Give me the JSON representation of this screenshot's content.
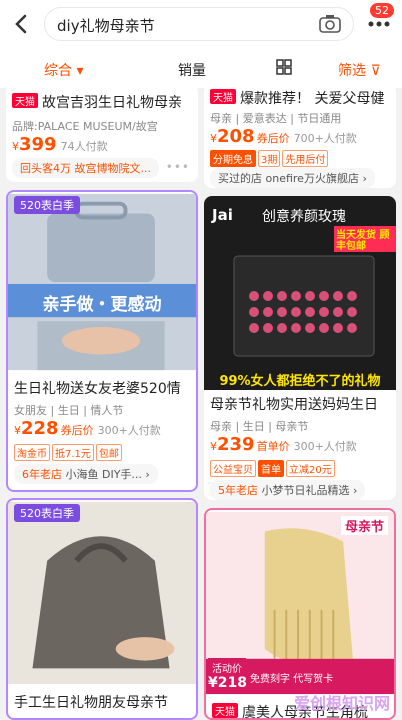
{
  "search": {
    "query": "diy礼物母亲节"
  },
  "notification_count": "52",
  "sort": {
    "comprehensive": "综合",
    "sales": "销量",
    "filter": "筛选"
  },
  "cards": [
    {
      "title": "故宫吉羽生日礼物母亲",
      "tag": "天猫",
      "attrs": "品牌:PALACE MUSEUM/故宫",
      "price": "399",
      "sold": "74人付款",
      "shop": "回头客4万 故宫博物院文..."
    },
    {
      "title": "爆款推荐！ 关爱父母健",
      "tag": "天猫",
      "attrs": "母亲 | 爱意表达 | 节日通用",
      "price": "208",
      "price_label": "券后价",
      "sold": "700+人付款",
      "chips": [
        "分期免息",
        "3期",
        "先用后付"
      ],
      "shop_prefix": "买过的店",
      "shop": "onefire万火旗舰店"
    },
    {
      "title": "生日礼物送女友老婆520情",
      "season": "520表白季",
      "banner": "亲手做・更感动",
      "attrs": "女朋友 | 生日 | 情人节",
      "price": "228",
      "price_label": "券后价",
      "sold": "300+人付款",
      "chips": [
        "淘金币",
        "抵7.1元",
        "包邮"
      ],
      "shop_prefix": "6年老店",
      "shop": "小海鱼 DIY手..."
    },
    {
      "title": "母亲节礼物实用送妈妈生日",
      "brand": "Jai",
      "headline": "创意养颜玫瑰",
      "promo": "当天发货 顾丰包邮",
      "caption": "99%女人都拒绝不了的礼物",
      "attrs": "母亲 | 生日 | 母亲节",
      "price": "239",
      "price_label": "首单价",
      "sold": "300+人付款",
      "chips": [
        "公益宝贝",
        "首单",
        "立减20元"
      ],
      "shop_prefix": "5年老店",
      "shop": "小梦节日礼品精选"
    },
    {
      "title": "手工生日礼物朋友母亲节",
      "season": "520表白季"
    },
    {
      "title": "虞美人母亲节生角梳",
      "tag": "天猫",
      "corner": "母亲节",
      "price_label": "活动价",
      "price": "218",
      "extra": "免费刻字 代写贺卡"
    }
  ],
  "watermark": "爱创根知识网"
}
